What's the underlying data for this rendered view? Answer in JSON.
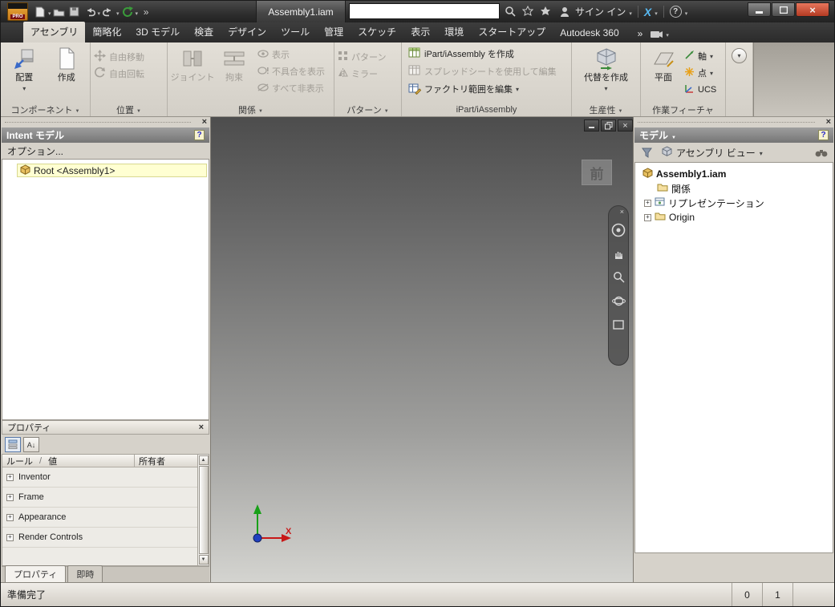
{
  "titlebar": {
    "app_badge": "PRO",
    "doc_tab": "Assembly1.iam",
    "search_value": "",
    "sign_in_label": "サイン イン",
    "exchange_label": "X"
  },
  "tabs": {
    "items": [
      "アセンブリ",
      "簡略化",
      "3D モデル",
      "検査",
      "デザイン",
      "ツール",
      "管理",
      "スケッチ",
      "表示",
      "環境",
      "スタートアップ",
      "Autodesk 360"
    ],
    "overflow": "»"
  },
  "ribbon": {
    "component": {
      "title": "コンポーネント",
      "place": "配置",
      "create": "作成"
    },
    "position": {
      "title": "位置",
      "free_move": "自由移動",
      "free_rotate": "自由回転"
    },
    "relations": {
      "title": "関係",
      "joint": "ジョイント",
      "constrain": "拘束",
      "show": "表示",
      "show_sick": "不具合を表示",
      "hide_all": "すべて非表示"
    },
    "pattern": {
      "title": "パターン",
      "pattern": "パターン",
      "mirror": "ミラー"
    },
    "ipart": {
      "title": "iPart/iAssembly",
      "create": "iPart/iAssembly を作成",
      "edit_sheet": "スプレッドシートを使用して編集",
      "edit_factory": "ファクトリ範囲を編集"
    },
    "productivity": {
      "title": "生産性",
      "substitute": "代替を作成"
    },
    "work": {
      "title": "作業フィーチャ",
      "plane": "平面",
      "axis": "軸",
      "point": "点",
      "ucs": "UCS"
    }
  },
  "left": {
    "intent_title": "Intent モデル",
    "options": "オプション...",
    "root": "Root <Assembly1>",
    "props": {
      "title": "プロパティ",
      "col_rule": "ルール",
      "col_sep": "/",
      "col_value": "値",
      "col_owner": "所有者",
      "rows": [
        "Inventor",
        "Frame",
        "Appearance",
        "Render Controls"
      ],
      "tab_props": "プロパティ",
      "tab_instant": "即時"
    }
  },
  "viewport": {
    "front": "前",
    "x_label": "X"
  },
  "right": {
    "title": "モデル",
    "view_combo": "アセンブリ ビュー",
    "tree": [
      "Assembly1.iam",
      "関係",
      "リプレゼンテーション",
      "Origin"
    ]
  },
  "status": {
    "ready": "準備完了",
    "count0": "0",
    "count1": "1"
  },
  "colors": {
    "close_button": "#c23a22",
    "highlight_row": "#ffffd2",
    "accent_blue": "#3a6ac8"
  }
}
